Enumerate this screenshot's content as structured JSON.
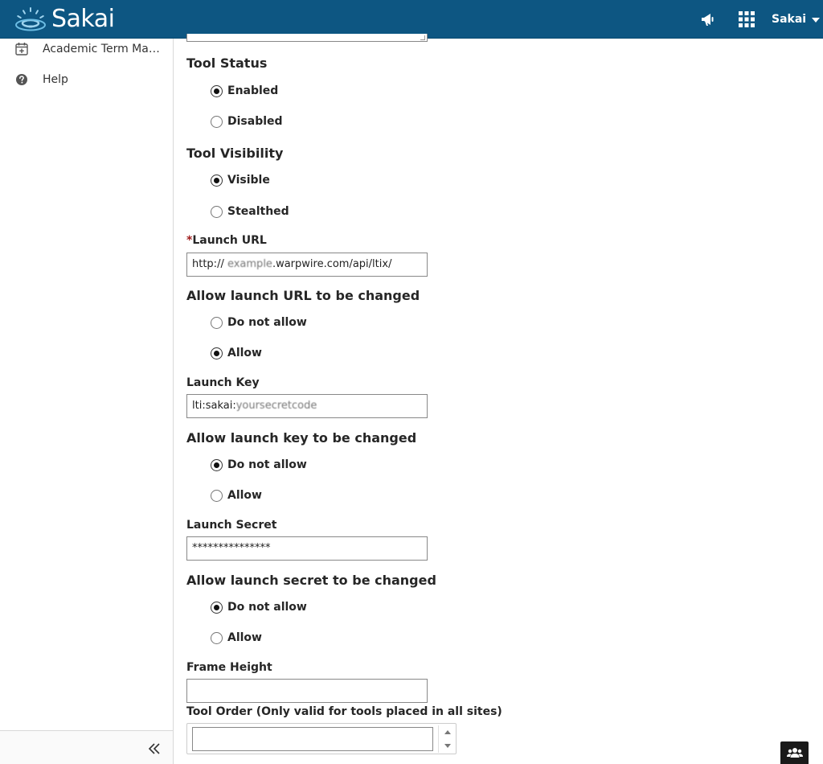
{
  "header": {
    "logo_text": "Sakai",
    "user_name": "Sakai",
    "icons": [
      "megaphone-icon",
      "apps-grid-icon",
      "chevron-down-icon"
    ]
  },
  "sidebar": {
    "items": [
      {
        "label": "Academic Term Man...",
        "icon": "calendar-plus-icon"
      },
      {
        "label": "Help",
        "icon": "question-circle-icon"
      }
    ],
    "collapse_icon": "double-chevron-left-icon"
  },
  "form": {
    "tool_status": {
      "title": "Tool Status",
      "options": [
        "Enabled",
        "Disabled"
      ],
      "selected": "Enabled"
    },
    "tool_visibility": {
      "title": "Tool Visibility",
      "options": [
        "Visible",
        "Stealthed"
      ],
      "selected": "Visible"
    },
    "launch_url": {
      "required_mark": "*",
      "label": "Launch URL",
      "value_prefix": "http://",
      "value_blurred": "example",
      "value_suffix": ".warpwire.com/api/ltix/"
    },
    "allow_url_change": {
      "title": "Allow launch URL to be changed",
      "options": [
        "Do not allow",
        "Allow"
      ],
      "selected": "Allow"
    },
    "launch_key": {
      "label": "Launch Key",
      "value_prefix": "lti:sakai:",
      "value_blurred": "yoursecretcode"
    },
    "allow_key_change": {
      "title": "Allow launch key to be changed",
      "options": [
        "Do not allow",
        "Allow"
      ],
      "selected": "Do not allow"
    },
    "launch_secret": {
      "label": "Launch Secret",
      "value": "***************"
    },
    "allow_secret_change": {
      "title": "Allow launch secret to be changed",
      "options": [
        "Do not allow",
        "Allow"
      ],
      "selected": "Do not allow"
    },
    "frame_height": {
      "label": "Frame Height",
      "value": ""
    },
    "tool_order": {
      "label": "Tool Order (Only valid for tools placed in all sites)",
      "value": ""
    }
  },
  "colors": {
    "header_bg": "#0d5682",
    "required": "#a01c1c",
    "chat_button_bg": "#1a1a1a"
  },
  "chat_icon": "users-icon"
}
